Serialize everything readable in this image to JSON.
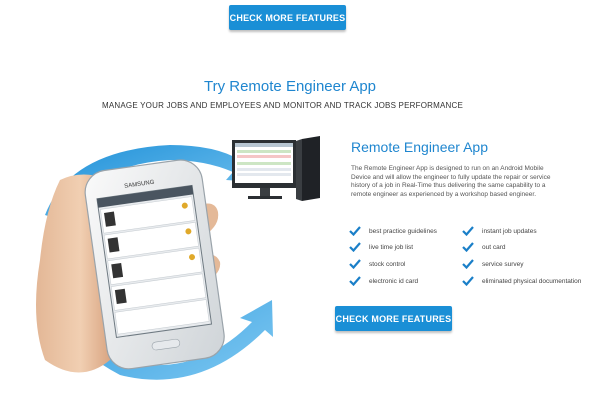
{
  "top_button": {
    "label": "CHECK MORE FEATURES"
  },
  "section": {
    "title": "Try Remote Engineer App",
    "subtitle": "MANAGE YOUR JOBS AND EMPLOYEES AND MONITOR AND TRACK JOBS PERFORMANCE"
  },
  "app": {
    "title": "Remote Engineer App",
    "description": "The Remote Engineer App is designed to run on an Android Mobile Device and will allow the engineer to fully update the repair or service history of a job in Real-Time thus delivering the same capability to a remote engineer as experienced by a workshop based engineer.",
    "features": [
      "best practice guidelines",
      "instant job updates",
      "live time job list",
      "out card",
      "stock control",
      "service survey",
      "electronic id card",
      "eliminated physical documentation"
    ]
  },
  "phone": {
    "brand": "SAMSUNG"
  },
  "bottom_button": {
    "label": "CHECK MORE FEATURES"
  },
  "colors": {
    "accent": "#1a8fd6",
    "title_blue": "#1f86cf",
    "check_blue": "#1a7fc8"
  }
}
